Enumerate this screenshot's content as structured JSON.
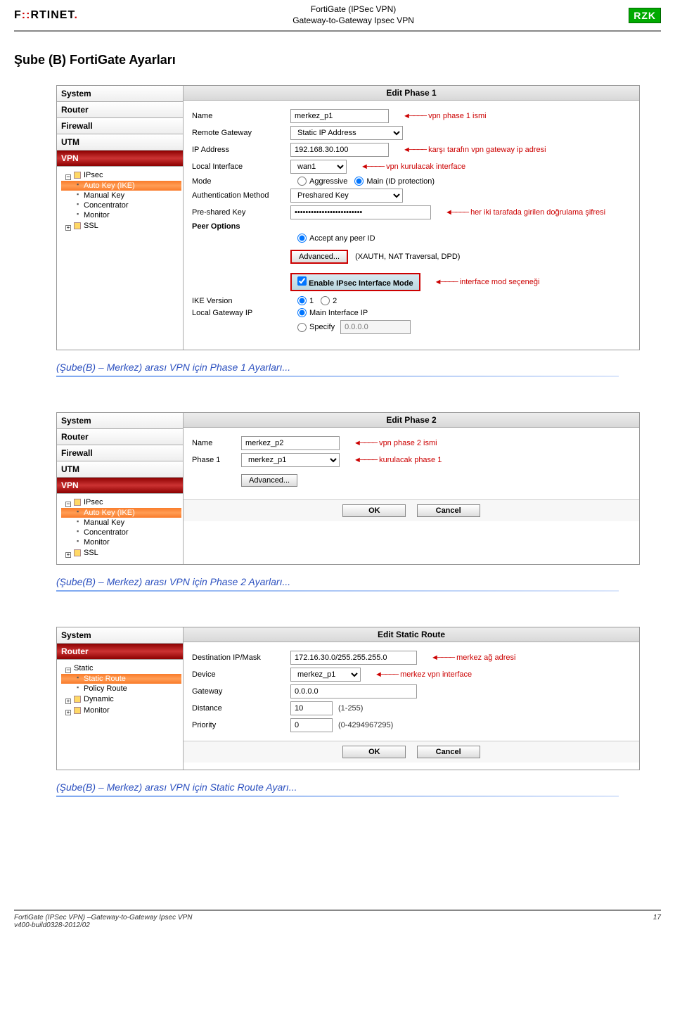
{
  "header": {
    "title1": "FortiGate (IPSec VPN)",
    "title2": "Gateway-to-Gateway Ipsec VPN",
    "logo": "FORTINET",
    "logo2": "RZK"
  },
  "section_title": "Şube (B) FortiGate Ayarları",
  "sidebar": {
    "secs": [
      "System",
      "Router",
      "Firewall",
      "UTM",
      "VPN"
    ],
    "ipsec": "IPsec",
    "children": [
      "Auto Key (IKE)",
      "Manual Key",
      "Concentrator",
      "Monitor"
    ],
    "ssl": "SSL"
  },
  "phase1": {
    "panel_title": "Edit Phase 1",
    "rows": {
      "name_lbl": "Name",
      "name_val": "merkez_p1",
      "rg_lbl": "Remote Gateway",
      "rg_val": "Static IP Address",
      "ip_lbl": "IP Address",
      "ip_val": "192.168.30.100",
      "li_lbl": "Local Interface",
      "li_val": "wan1",
      "mode_lbl": "Mode",
      "mode_a": "Aggressive",
      "mode_b": "Main (ID protection)",
      "auth_lbl": "Authentication Method",
      "auth_val": "Preshared Key",
      "psk_lbl": "Pre-shared Key",
      "psk_val": "•••••••••••••••••••••••••",
      "peer_lbl": "Peer Options",
      "peer_a": "Accept any peer ID",
      "adv_btn": "Advanced...",
      "adv_hint": "(XAUTH, NAT Traversal, DPD)",
      "enable": "Enable IPsec Interface Mode",
      "ike_lbl": "IKE Version",
      "ike1": "1",
      "ike2": "2",
      "lgw_lbl": "Local Gateway IP",
      "lgw_a": "Main Interface IP",
      "lgw_b": "Specify",
      "lgw_val": "0.0.0.0"
    },
    "annots": {
      "name": "vpn phase 1 ismi",
      "ip": "karşı tarafın vpn gateway ip adresi",
      "li": "vpn kurulacak interface",
      "psk": "her iki tarafada girilen doğrulama şifresi",
      "enable": "interface mod seçeneği"
    }
  },
  "caption1": "(Şube(B) – Merkez) arası VPN için Phase 1 Ayarları...",
  "phase2": {
    "panel_title": "Edit Phase 2",
    "name_lbl": "Name",
    "name_val": "merkez_p2",
    "name_ann": "vpn phase 2 ismi",
    "p1_lbl": "Phase 1",
    "p1_val": "merkez_p1",
    "p1_ann": "kurulacak phase 1",
    "adv": "Advanced...",
    "ok": "OK",
    "cancel": "Cancel"
  },
  "caption2": "(Şube(B) – Merkez) arası VPN için Phase 2 Ayarları...",
  "route_sidebar": {
    "secs": [
      "System",
      "Router"
    ],
    "static": "Static",
    "children": [
      "Static Route",
      "Policy Route"
    ],
    "dynamic": "Dynamic",
    "monitor": "Monitor"
  },
  "route": {
    "panel_title": "Edit Static Route",
    "dst_lbl": "Destination IP/Mask",
    "dst_val": "172.16.30.0/255.255.255.0",
    "dst_ann": "merkez ağ adresi",
    "dev_lbl": "Device",
    "dev_val": "merkez_p1",
    "dev_ann": "merkez vpn interface",
    "gw_lbl": "Gateway",
    "gw_val": "0.0.0.0",
    "dist_lbl": "Distance",
    "dist_val": "10",
    "dist_hint": "(1-255)",
    "pri_lbl": "Priority",
    "pri_val": "0",
    "pri_hint": "(0-4294967295)",
    "ok": "OK",
    "cancel": "Cancel"
  },
  "caption3": "(Şube(B) – Merkez) arası VPN için Static Route Ayarı...",
  "footer": {
    "line1": "FortiGate (IPSec VPN) –Gateway-to-Gateway Ipsec VPN",
    "line2": "v400-build0328-2012/02",
    "page": "17"
  }
}
